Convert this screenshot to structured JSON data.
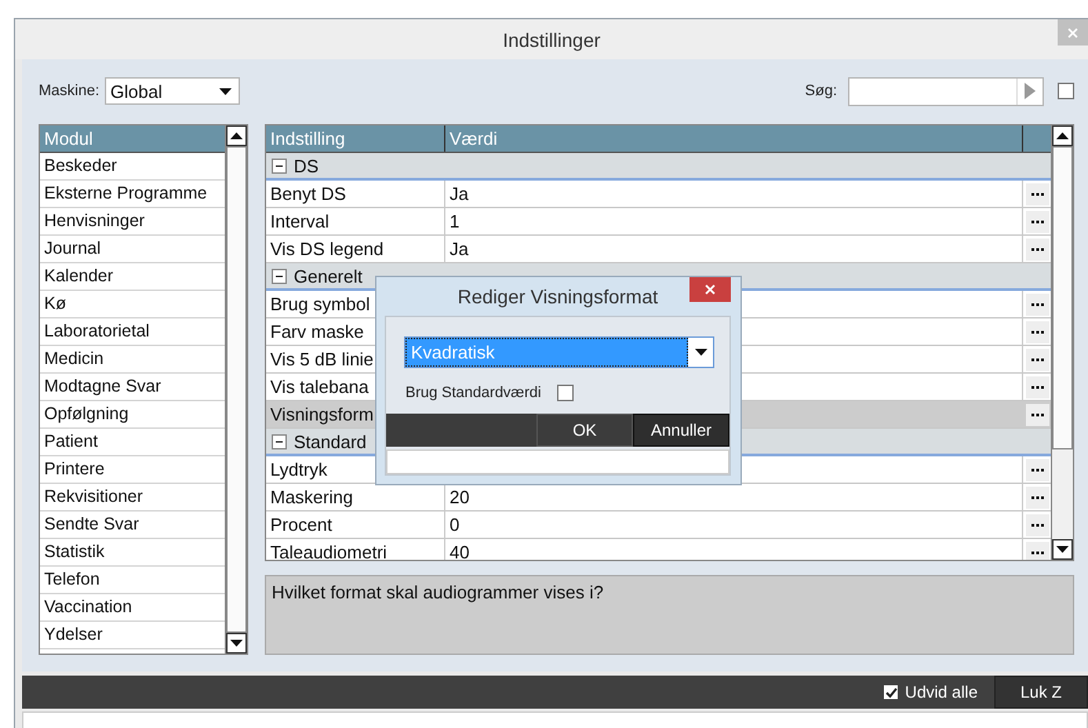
{
  "window": {
    "title": "Indstillinger"
  },
  "toolbar": {
    "machine_label": "Maskine:",
    "machine_value": "Global",
    "search_label": "Søg:",
    "search_checked": false
  },
  "modules": {
    "header": "Modul",
    "items": [
      {
        "label": "Beskeder",
        "selected": false
      },
      {
        "label": "Eksterne Programme",
        "selected": false
      },
      {
        "label": "Henvisninger",
        "selected": false
      },
      {
        "label": "Journal",
        "selected": false
      },
      {
        "label": "Kalender",
        "selected": false
      },
      {
        "label": "Kø",
        "selected": false
      },
      {
        "label": "Laboratorietal",
        "selected": false
      },
      {
        "label": "Medicin",
        "selected": false
      },
      {
        "label": "Modtagne Svar",
        "selected": false
      },
      {
        "label": "Opfølgning",
        "selected": false
      },
      {
        "label": "Patient",
        "selected": false
      },
      {
        "label": "Printere",
        "selected": false
      },
      {
        "label": "Rekvisitioner",
        "selected": false
      },
      {
        "label": "Sendte Svar",
        "selected": false
      },
      {
        "label": "Statistik",
        "selected": false
      },
      {
        "label": "Telefon",
        "selected": false
      },
      {
        "label": "Vaccination",
        "selected": false
      },
      {
        "label": "Ydelser",
        "selected": false
      }
    ]
  },
  "grid": {
    "columns": [
      "Indstilling",
      "Værdi"
    ],
    "rows": [
      {
        "kind": "group",
        "label": "DS",
        "expanded": true
      },
      {
        "kind": "setting",
        "label": "Benyt DS",
        "value": "Ja",
        "selected": false
      },
      {
        "kind": "setting",
        "label": "Interval",
        "value": "1",
        "selected": false
      },
      {
        "kind": "setting",
        "label": "Vis DS legend",
        "value": "Ja",
        "selected": false
      },
      {
        "kind": "group",
        "label": "Generelt",
        "expanded": true
      },
      {
        "kind": "setting",
        "label": "Brug symbol",
        "selected": false
      },
      {
        "kind": "setting",
        "label": "Farv maske",
        "selected": false
      },
      {
        "kind": "setting",
        "label": "Vis 5 dB linie",
        "selected": false
      },
      {
        "kind": "setting",
        "label": "Vis talebana",
        "selected": false
      },
      {
        "kind": "setting",
        "label": "Visningsform",
        "selected": true
      },
      {
        "kind": "group",
        "label": "Standard",
        "expanded": true
      },
      {
        "kind": "setting",
        "label": "Lydtryk",
        "selected": false
      },
      {
        "kind": "setting",
        "label": "Maskering",
        "value": "20",
        "selected": false
      },
      {
        "kind": "setting",
        "label": "Procent",
        "value": "0",
        "selected": false
      },
      {
        "kind": "setting",
        "label": "Taleaudiometri",
        "value": "40",
        "selected": false
      }
    ]
  },
  "description": "Hvilket format skal audiogrammer vises i?",
  "footer": {
    "expand_all_label": "Udvid alle",
    "expand_all_checked": true,
    "close_button": "Luk Z"
  },
  "dialog": {
    "title": "Rediger Visningsformat",
    "format_value": "Kvadratisk",
    "use_default_label": "Brug Standardværdi",
    "use_default_checked": false,
    "buttons": [
      "OK",
      "Annuller"
    ]
  }
}
